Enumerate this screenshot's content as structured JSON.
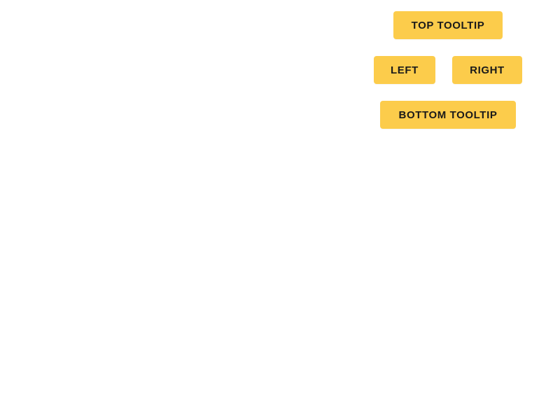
{
  "buttons": {
    "top": "TOP TOOLTIP",
    "left": "LEFT",
    "right": "RIGHT",
    "bottom": "BOTTOM TOOLTIP"
  },
  "colors": {
    "button_background": "#fccc4b",
    "button_text": "#1a1a1a",
    "page_background": "#ffffff"
  }
}
